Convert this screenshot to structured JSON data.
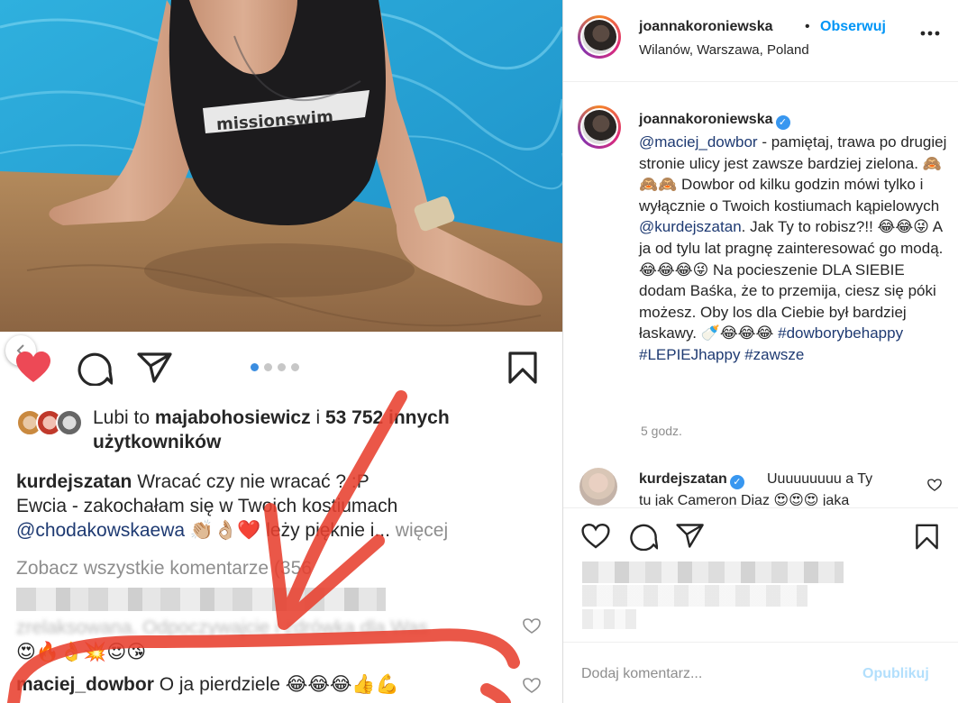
{
  "left_screenshot": {
    "likes": {
      "prefix": "Lubi to ",
      "user": "majabohosiewicz",
      "middle": " i ",
      "count": "53 752 innych",
      "suffix": "użytkowników"
    },
    "caption": {
      "user": "kurdejszatan",
      "text1": " Wracać czy nie wracać ? :P",
      "text2": "Ewcia - zakochałam się w Twoich kostiumach",
      "mention": "@chodakowskaewa",
      "emojis": " 👏🏼👌🏼❤️ ",
      "text3": "leży pięknie i...",
      "more": " więcej"
    },
    "view_all_comments": "Zobacz wszystkie komentarze (356",
    "comment_blurred_partial": "zrelaksowana. Odpoczywajcie i zdrówka dla Was",
    "comment_emojis": "😍🔥👌💥😍😘",
    "last_comment": {
      "user": "maciej_dowbor",
      "text": " O ja pierdziele ",
      "emojis": "😂😂😂👍💪"
    },
    "carousel_dots": 4,
    "active_dot": 1
  },
  "header": {
    "username": "joannakoroniewska",
    "dot": "•",
    "follow_label": "Obserwuj",
    "location": "Wilanów, Warszawa, Poland"
  },
  "caption": {
    "username": "joannakoroniewska",
    "mention1": "@maciej_dowbor",
    "text1": " - pamiętaj, trawa po drugiej stronie ulicy jest zawsze bardziej zielona. 🙈🙈🙈 Dowbor od kilku godzin mówi tylko i wyłącznie o Twoich kostiumach kąpielowych ",
    "mention2": "@kurdejszatan",
    "text2": ". Jak Ty to robisz?!! 😂😂😜 A ja od tylu lat pragnę zainteresować go modą. 😂😂😂😜 Na pocieszenie DLA SIEBIE dodam Baśka, że to przemija, ciesz się póki możesz. Oby los dla Ciebie był bardziej łaskawy. 🍼😂😂😂 ",
    "hashtags": "#dowborybehappy #LEPIEJhappy #zawsze",
    "time": "5 godz."
  },
  "comment": {
    "username": "kurdejszatan",
    "text": "Uuuuuuuuu a Ty",
    "line2": "tu jak Cameron Diaz 😍😍😍 jaka"
  },
  "footer": {
    "add_comment_placeholder": "Dodaj komentarz...",
    "publish_label": "Opublikuj"
  },
  "colors": {
    "link": "#1e3a72",
    "follow": "#0095f6",
    "like_red": "#ed4956",
    "publish_disabled": "#b2dffc",
    "annotation_red": "#e8402f"
  }
}
